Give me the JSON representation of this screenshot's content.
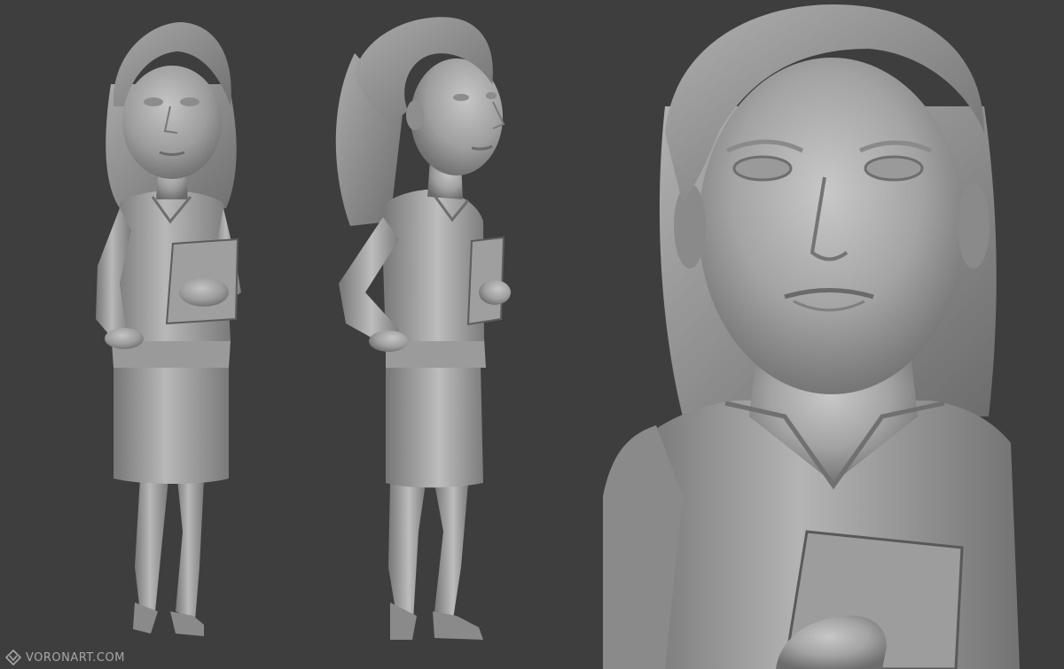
{
  "watermark": {
    "text": "VORONART.COM",
    "icon": "voronart-logo-icon"
  },
  "colors": {
    "background": "#3e3e3e",
    "sculpt_light": "#b5b5b5",
    "sculpt_mid": "#8f8f8f",
    "sculpt_dark": "#5c5c5c"
  },
  "views": [
    {
      "name": "front-view"
    },
    {
      "name": "three-quarter-view"
    },
    {
      "name": "closeup-view"
    }
  ]
}
